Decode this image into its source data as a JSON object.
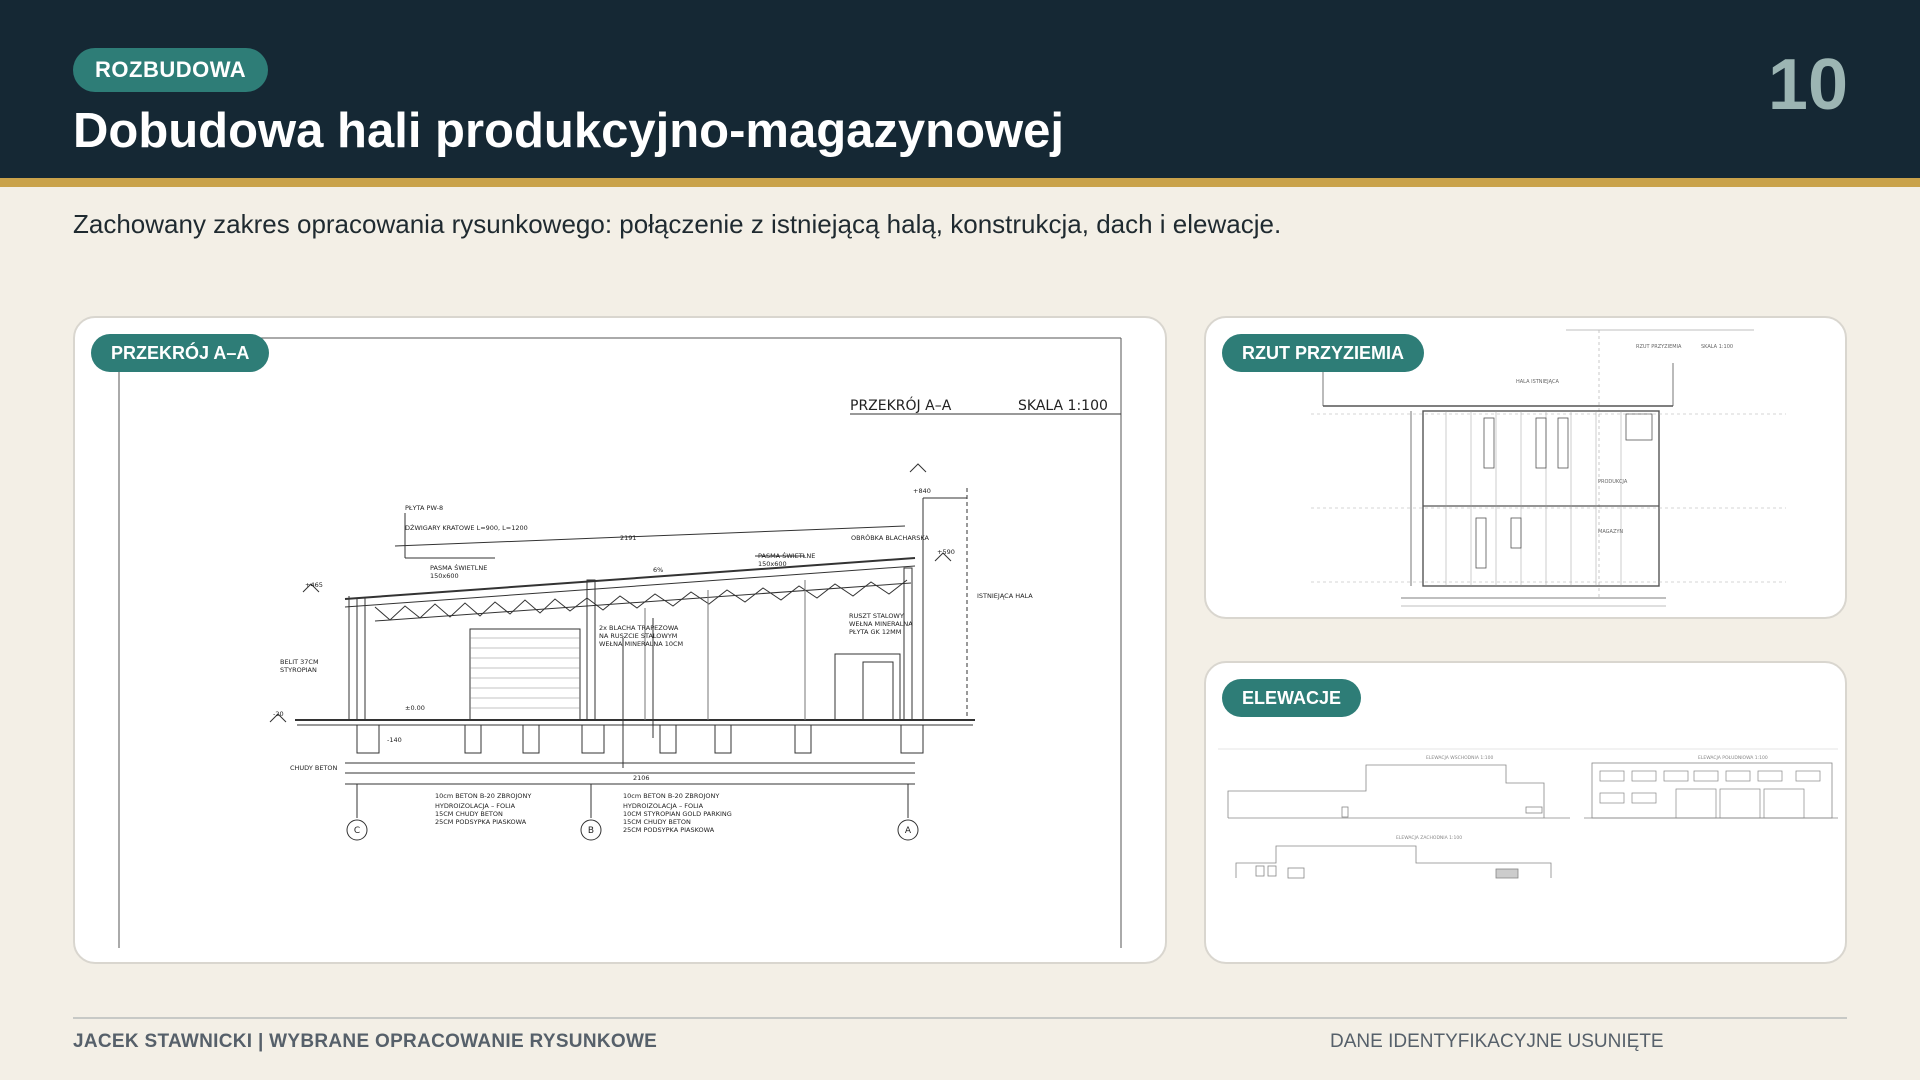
{
  "header": {
    "tag": "ROZBUDOWA",
    "title": "Dobudowa hali produkcyjno-magazynowej",
    "page_number": "10"
  },
  "subtitle": "Zachowany zakres opracowania rysunkowego: połączenie z istniejącą halą, konstrukcja, dach i elewacje.",
  "panels": {
    "section": {
      "label": "PRZEKRÓJ A–A",
      "drawing_title": "PRZEKRÓJ A–A",
      "drawing_scale": "SKALA 1:100",
      "notes": {
        "roof_panel": "PŁYTA PW-8",
        "girder": "DŹWIGARY KRATOWE L=900, L=1200",
        "skylight_left": "PASMA ŚWIETLNE",
        "skylight_left_size": "150x600",
        "skylight_right": "PASMA ŚWIETLNE",
        "skylight_right_size": "150x600",
        "flashing": "OBRÓBKA BLACHARSKA",
        "existing_hall": "ISTNIEJĄCA HALA",
        "roof_build": "2x BLACHA TRAPEZOWA",
        "roof_build_2": "NA RUSZCIE STALOWYM",
        "roof_build_3": "WEŁNA MINERALNA 10CM",
        "frame": "RUSZT STALOWY",
        "frame_2": "WEŁNA MINERALNA",
        "frame_3": "PŁYTA GK 12MM",
        "wall": "BELIT 37CM",
        "wall_2": "STYROPIAN",
        "lean_concrete": "CHUDY BETON",
        "floor_1": "10cm BETON B-20 ZBROJONY",
        "floor_2": "HYDROIZOLACJA – FOLIA",
        "floor_3": "15CM CHUDY BETON",
        "floor_4": "25CM PODSYPKA PIASKOWA",
        "floor_b_1": "10cm BETON B-20 ZBROJONY",
        "floor_b_2": "HYDROIZOLACJA – FOLIA",
        "floor_b_3": "10CM STYROPIAN GOLD PARKING",
        "floor_b_4": "15CM CHUDY BETON",
        "floor_b_5": "25CM PODSYPKA PIASKOWA"
      },
      "levels": {
        "top": "+840",
        "ridge": "+590",
        "eave": "+465",
        "zero": "±0.00",
        "minus": "-20",
        "base": "-140"
      },
      "slope_text": "6%",
      "dimension_length": "2106",
      "dimension_top": "2191",
      "axes": [
        "C",
        "B",
        "A"
      ]
    },
    "plan": {
      "label": "RZUT PRZYZIEMIA",
      "drawing_title": "RZUT PRZYZIEMIA",
      "drawing_scale": "SKALA 1:100",
      "existing": "HALA ISTNIEJĄCA",
      "room_1": "PRODUKCJA",
      "room_2": "MAGAZYN"
    },
    "elevations": {
      "label": "ELEWACJE",
      "title_1": "ELEWACJA WSCHODNIA 1:100",
      "title_2": "ELEWACJA POŁUDNIOWA 1:100",
      "title_3": "ELEWACJA ZACHODNIA 1:100"
    }
  },
  "footer": {
    "left": "JACEK STAWNICKI  |  WYBRANE OPRACOWANIE RYSUNKOWE",
    "right": "DANE IDENTYFIKACYJNE USUNIĘTE"
  },
  "colors": {
    "header_bg": "#152834",
    "accent_stripe": "#c9a24a",
    "teal": "#2e7d77",
    "page_bg": "#f3efe6"
  }
}
